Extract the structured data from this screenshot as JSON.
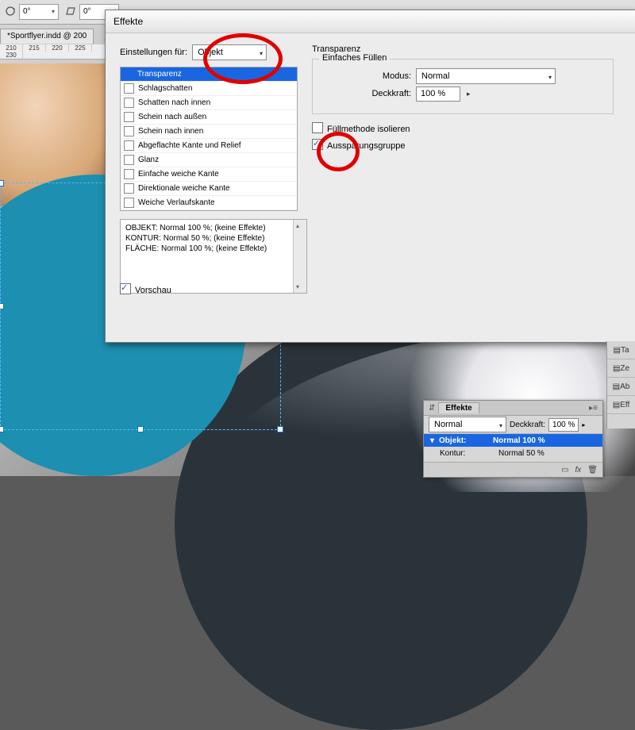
{
  "top": {
    "val1": "0°",
    "val2": "0°",
    "doc_tab": "*Sportflyer.indd @ 200",
    "ruler": [
      "210",
      "215",
      "220",
      "225",
      "230"
    ]
  },
  "dialog": {
    "title": "Effekte",
    "settings_label": "Einstellungen für:",
    "settings_value": "Objekt",
    "effects": [
      "Transparenz",
      "Schlagschatten",
      "Schatten nach innen",
      "Schein nach außen",
      "Schein nach innen",
      "Abgeflachte Kante und Relief",
      "Glanz",
      "Einfache weiche Kante",
      "Direktionale weiche Kante",
      "Weiche Verlaufskante"
    ],
    "summary": [
      "OBJEKT: Normal 100 %; (keine Effekte)",
      "KONTUR: Normal 50 %; (keine Effekte)",
      "FLÄCHE: Normal 100 %; (keine Effekte)"
    ],
    "right": {
      "title": "Transparenz",
      "group": "Einfaches Füllen",
      "mode_label": "Modus:",
      "mode_value": "Normal",
      "opacity_label": "Deckkraft:",
      "opacity_value": "100 %",
      "isolate": "Füllmethode isolieren",
      "knockout": "Aussparungsgruppe"
    },
    "preview": "Vorschau"
  },
  "side_labels": [
    "Ta",
    "Ze",
    "Ab",
    "Eff"
  ],
  "fx_panel": {
    "title": "Effekte",
    "mode": "Normal",
    "op_label": "Deckkraft:",
    "op_value": "100 %",
    "rows": [
      {
        "k": "Objekt:",
        "v": "Normal 100 %"
      },
      {
        "k": "Kontur:",
        "v": "Normal 50 %"
      }
    ],
    "fx_icon": "fx"
  }
}
